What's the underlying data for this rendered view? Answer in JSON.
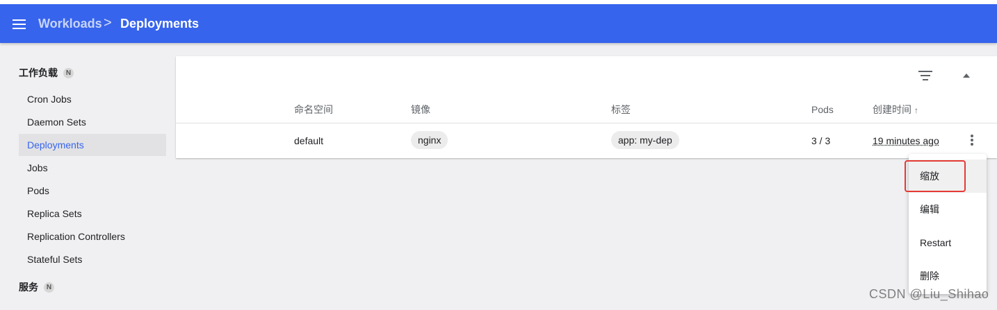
{
  "toolbar": {
    "breadcrumb_parent": "Workloads",
    "breadcrumb_separator": ">",
    "breadcrumb_current": "Deployments",
    "color": "#3764ec"
  },
  "sidebar": {
    "section1": {
      "label": "工作负载",
      "badge": "N"
    },
    "items": [
      {
        "label": "Cron Jobs",
        "active": false
      },
      {
        "label": "Daemon Sets",
        "active": false
      },
      {
        "label": "Deployments",
        "active": true
      },
      {
        "label": "Jobs",
        "active": false
      },
      {
        "label": "Pods",
        "active": false
      },
      {
        "label": "Replica Sets",
        "active": false
      },
      {
        "label": "Replication Controllers",
        "active": false
      },
      {
        "label": "Stateful Sets",
        "active": false
      }
    ],
    "section2": {
      "label": "服务",
      "badge": "N"
    }
  },
  "table": {
    "columns": {
      "namespace": "命名空间",
      "images": "镜像",
      "labels": "标签",
      "pods": "Pods",
      "created": "创建时间",
      "created_sort": "↑"
    },
    "rows": [
      {
        "namespace": "default",
        "image": "nginx",
        "label": "app: my-dep",
        "pods": "3 / 3",
        "created": "19 minutes ago"
      }
    ]
  },
  "action_menu": {
    "items": [
      "缩放",
      "编辑",
      "Restart",
      "删除"
    ],
    "highlight_color": "#e53935"
  },
  "watermark": "CSDN @Liu_Shihao"
}
